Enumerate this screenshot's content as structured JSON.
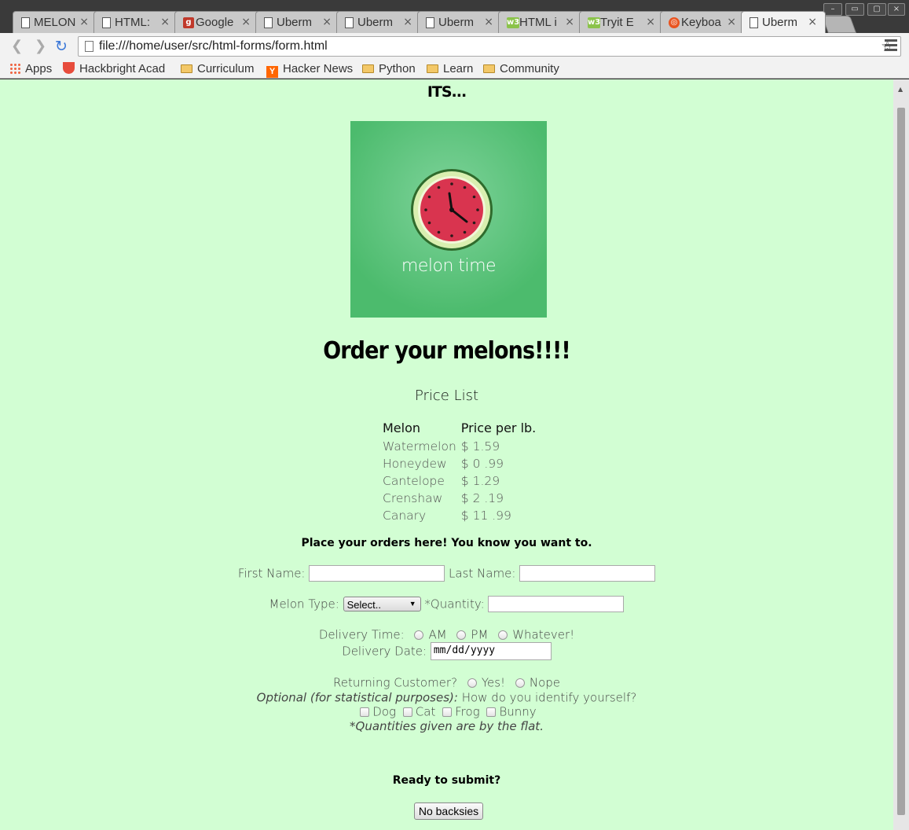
{
  "browser": {
    "tabs": [
      {
        "label": "MELON",
        "icon": "doc-icon"
      },
      {
        "label": "HTML:",
        "icon": "doc-icon"
      },
      {
        "label": "Google",
        "icon": "google-forms-icon"
      },
      {
        "label": "Uberm",
        "icon": "doc-icon"
      },
      {
        "label": "Uberm",
        "icon": "doc-icon"
      },
      {
        "label": "Uberm",
        "icon": "doc-icon"
      },
      {
        "label": "HTML i",
        "icon": "w3-icon"
      },
      {
        "label": "Tryit E",
        "icon": "w3-icon"
      },
      {
        "label": "Keyboa",
        "icon": "ubuntu-icon"
      },
      {
        "label": "Uberm",
        "icon": "doc-icon",
        "active": true
      }
    ],
    "tab_close": "×",
    "url": "file:///home/user/src/html-forms/form.html",
    "bookmarks": [
      {
        "label": "Apps",
        "icon": "apps-grid-icon"
      },
      {
        "label": "Hackbright Acad",
        "icon": "hackbright-icon"
      },
      {
        "label": "Curriculum",
        "icon": "folder-icon"
      },
      {
        "label": "Hacker News",
        "icon": "hacker-news-icon",
        "glyph": "Y"
      },
      {
        "label": "Python",
        "icon": "folder-icon"
      },
      {
        "label": "Learn",
        "icon": "folder-icon"
      },
      {
        "label": "Community",
        "icon": "folder-icon"
      }
    ]
  },
  "page": {
    "its": "ITS...",
    "logo_text": "melon time",
    "headline": "Order your melons!!!!",
    "price_list_title": "Price List",
    "price_table": {
      "headers": [
        "Melon",
        "Price per lb."
      ],
      "rows": [
        [
          "Watermelon",
          "$ 1.59"
        ],
        [
          "Honeydew",
          "$ 0 .99"
        ],
        [
          "Cantelope",
          "$ 1.29"
        ],
        [
          "Crenshaw",
          "$ 2 .19"
        ],
        [
          "Canary",
          "$ 11 .99"
        ]
      ]
    },
    "order_prompt": "Place your orders here! You know you want to.",
    "form": {
      "first_name_label": "First Name:",
      "first_name_value": "",
      "last_name_label": "Last Name:",
      "last_name_value": "",
      "melon_type_label": "Melon Type:",
      "melon_type_selected": "Select..",
      "quantity_label": "*Quantity:",
      "quantity_value": "",
      "delivery_time_label": "Delivery Time:",
      "delivery_time_options": [
        "AM",
        "PM",
        "Whatever!"
      ],
      "delivery_date_label": "Delivery Date:",
      "delivery_date_placeholder": "mm/dd/yyyy",
      "returning_label": "Returning Customer?",
      "returning_options": [
        "Yes!",
        "Nope"
      ],
      "optional_note": "Optional (for statistical purposes):",
      "identify_question": "How do you identify yourself?",
      "identity_options": [
        "Dog",
        "Cat",
        "Frog",
        "Bunny"
      ],
      "quantity_note": "*Quantities given are by the flat.",
      "ready_label": "Ready to submit?",
      "submit_label": "No backsies"
    }
  },
  "colors": {
    "page_background": "#d2fed3",
    "logo_green": "#4cbb6d",
    "melon_red": "#d9344f"
  }
}
